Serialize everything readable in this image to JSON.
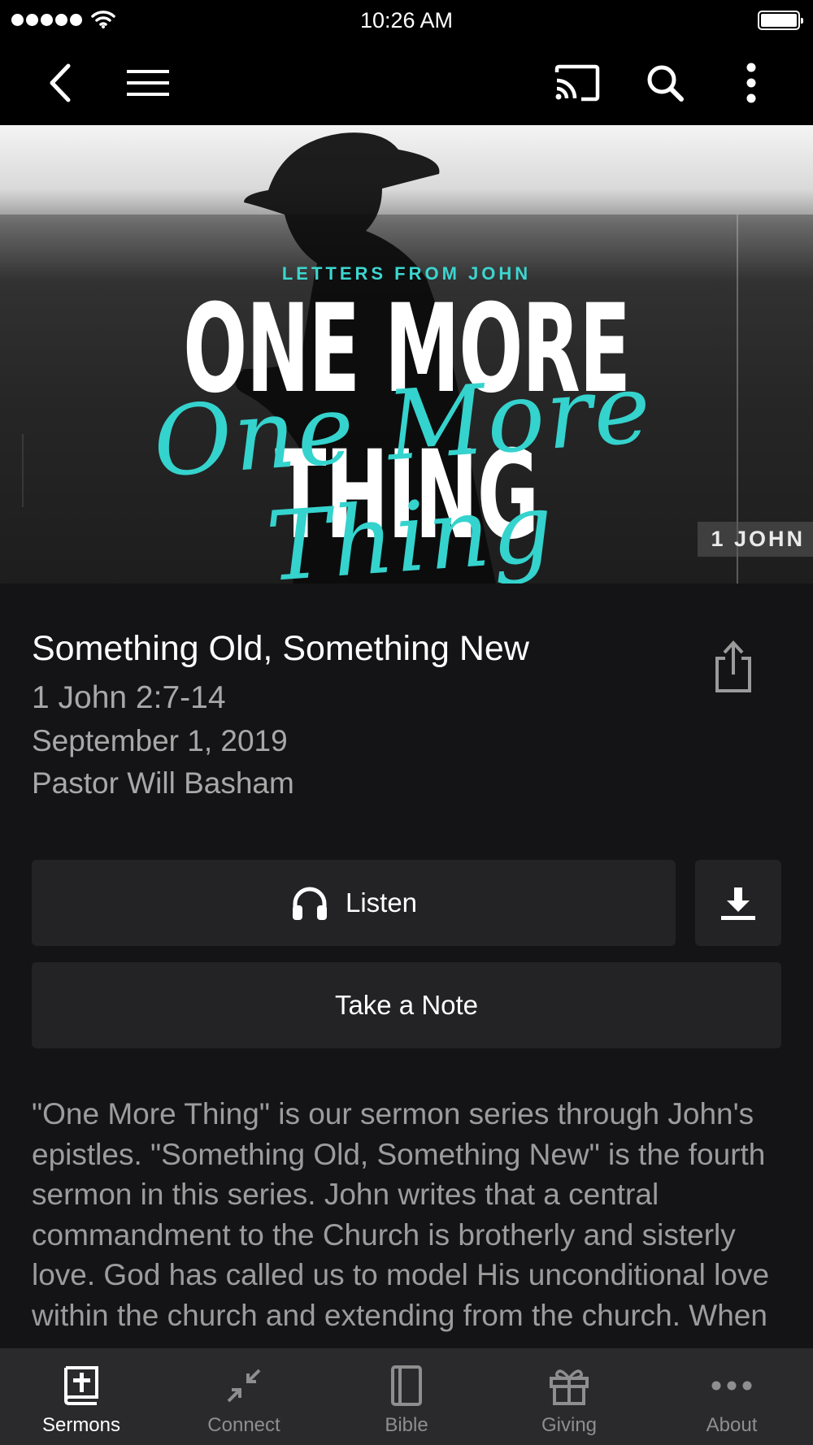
{
  "status_bar": {
    "time": "10:26 AM"
  },
  "nav": {
    "icons": [
      "back-icon",
      "menu-icon",
      "cast-icon",
      "search-icon",
      "more-vertical-icon"
    ]
  },
  "hero": {
    "series_label": "LETTERS FROM JOHN",
    "title": "ONE MORE THING",
    "script_title": "One More Thing",
    "tag": "1 JOHN"
  },
  "sermon": {
    "title": "Something Old, Something New",
    "scripture": "1 John 2:7-14",
    "date": "September 1, 2019",
    "speaker": "Pastor Will Basham"
  },
  "actions": {
    "listen_label": "Listen",
    "note_label": "Take a Note"
  },
  "description": "\"One More Thing\" is our sermon series through John's epistles. \"Something Old, Something New\" is the fourth sermon in this series. John writes that a central commandment to the Church is brotherly and sisterly love. God has called us to model His unconditional love within the church and extending from the church. When we live in this way, the",
  "tabs": [
    {
      "label": "Sermons",
      "icon": "bible-cross-icon",
      "active": true
    },
    {
      "label": "Connect",
      "icon": "arrows-in-icon",
      "active": false
    },
    {
      "label": "Bible",
      "icon": "book-icon",
      "active": false
    },
    {
      "label": "Giving",
      "icon": "gift-icon",
      "active": false
    },
    {
      "label": "About",
      "icon": "more-horizontal-icon",
      "active": false
    }
  ],
  "colors": {
    "accent": "#35d3cd",
    "background": "#141416",
    "button": "#232325",
    "tab_bar": "#2a2a2c"
  }
}
